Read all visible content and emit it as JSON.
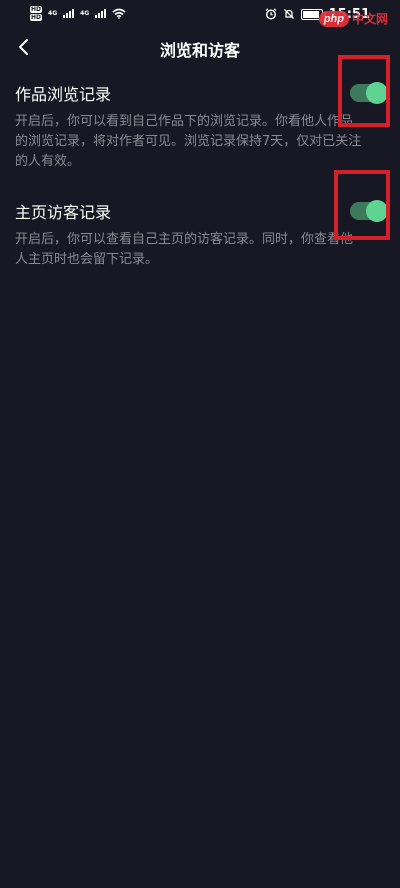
{
  "status_bar": {
    "sim1": "HD",
    "sim2": "HD",
    "net1": "4G",
    "net2": "4G",
    "time": "15:51",
    "battery_level": 0.8
  },
  "watermark": {
    "badge": "php",
    "text": "中文网"
  },
  "header": {
    "title": "浏览和访客"
  },
  "settings": [
    {
      "title": "作品浏览记录",
      "description": "开启后，你可以看到自己作品下的浏览记录。你看他人作品的浏览记录，将对作者可见。浏览记录保持7天，仅对已关注的人有效。",
      "enabled": true
    },
    {
      "title": "主页访客记录",
      "description": "开启后，你可以查看自己主页的访客记录。同时，你查看他人主页时也会留下记录。",
      "enabled": true
    }
  ],
  "colors": {
    "background": "#181824",
    "toggle_track": "#3d7a5c",
    "toggle_knob": "#5fd392",
    "highlight": "#d4202a",
    "secondary_text": "#8a8a93"
  }
}
